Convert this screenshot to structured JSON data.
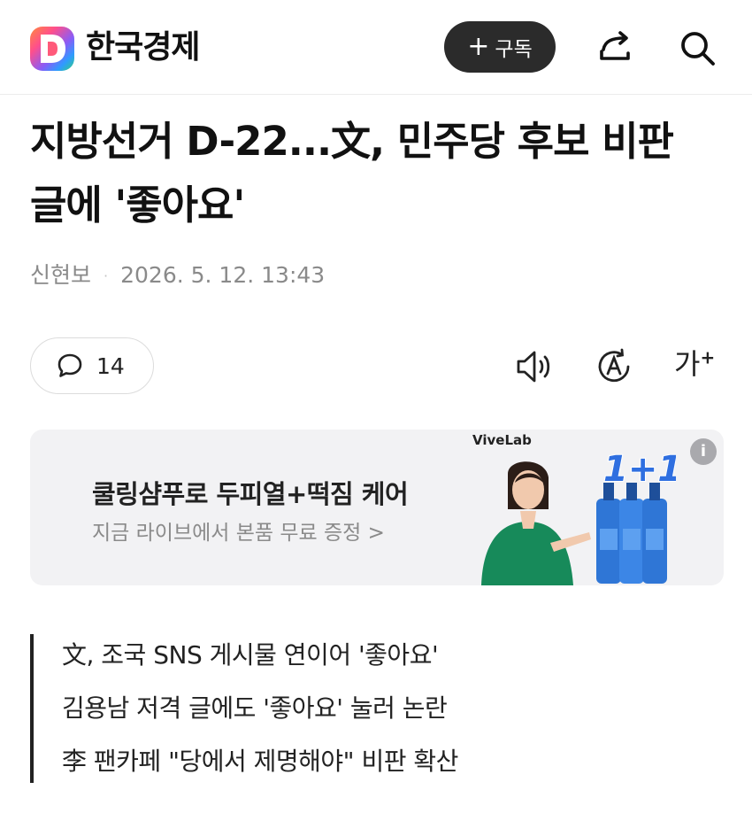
{
  "header": {
    "logo_letter": "D",
    "brand_name": "한국경제",
    "subscribe_label": "구독",
    "subscribe_prefix": "+"
  },
  "article": {
    "title": "지방선거 D-22...文, 민주당 후보 비판 글에 '좋아요'",
    "author": "신현보",
    "separator": "·",
    "date": "2026. 5. 12. 13:43"
  },
  "toolbar": {
    "comment_count": "14",
    "font_size_label": "가",
    "font_size_plus": "+"
  },
  "ad": {
    "brand": "ViveLab",
    "headline": "쿨링샴푸로 두피열+떡짐 케어",
    "subtext": "지금 라이브에서 본품 무료 증정 >",
    "promo": "1+1",
    "info": "i"
  },
  "summary": [
    "文, 조국 SNS 게시물 연이어 '좋아요'",
    "김용남 저격 글에도 '좋아요' 눌러 논란",
    "李 팬카페 \"당에서 제명해야\" 비판 확산"
  ],
  "colors": {
    "subscribe_bg": "#2b2b2b",
    "ad_bg": "#f2f2f4",
    "meta_text": "#8a8a8a",
    "promo_blue": "#2f6fe0"
  },
  "icons": [
    "daum-logo-icon",
    "share-icon",
    "search-icon",
    "comment-icon",
    "speaker-icon",
    "translate-icon",
    "font-size-icon",
    "info-icon"
  ]
}
